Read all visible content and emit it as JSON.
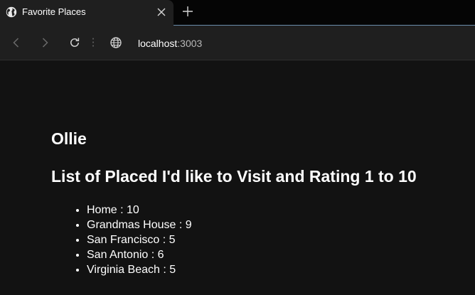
{
  "browser": {
    "tab": {
      "title": "Favorite Places"
    },
    "address": {
      "host": "localhost",
      "port": ":3003"
    }
  },
  "page": {
    "name": "Ollie",
    "list_title": "List of Placed I'd like to Visit and Rating 1 to 10",
    "places": [
      {
        "text": "Home : 10"
      },
      {
        "text": "Grandmas House : 9"
      },
      {
        "text": "San Francisco : 5"
      },
      {
        "text": "San Antonio : 6"
      },
      {
        "text": "Virginia Beach : 5"
      }
    ]
  }
}
